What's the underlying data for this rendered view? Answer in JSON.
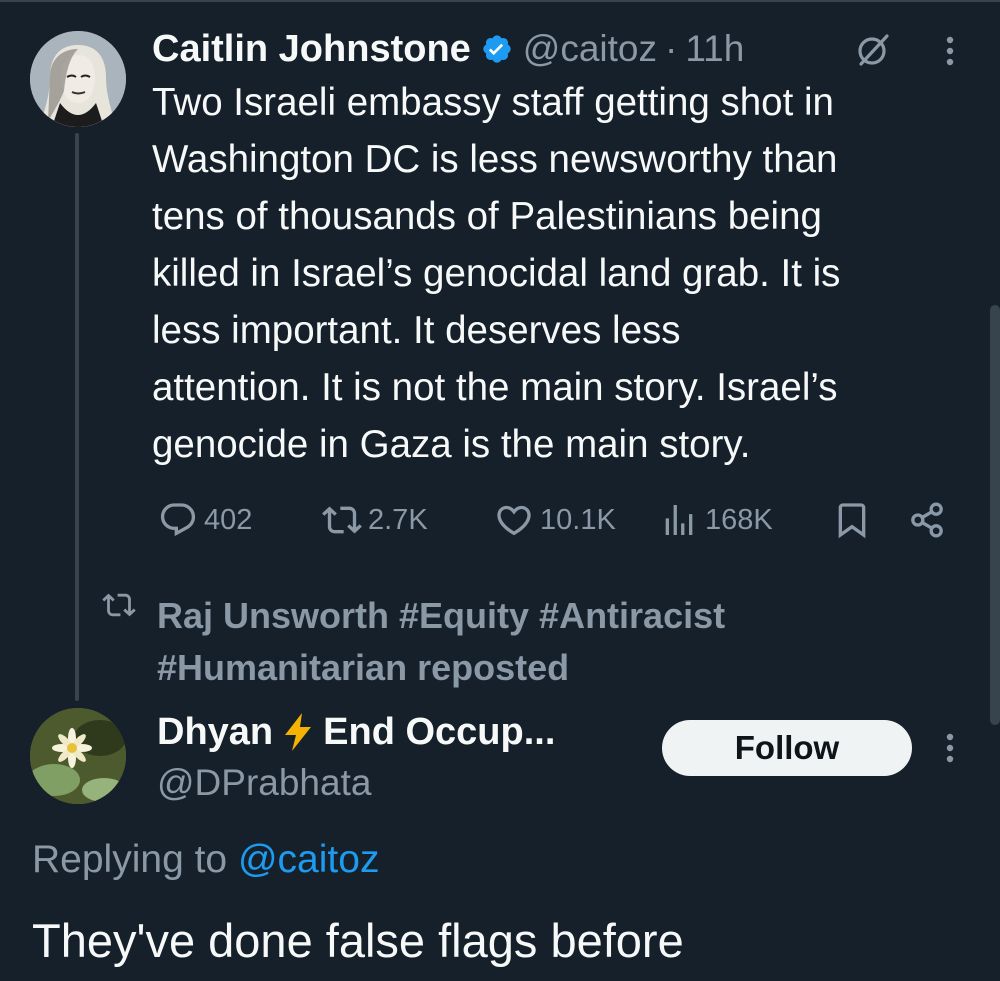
{
  "colors": {
    "background": "#15202b",
    "primary_text": "#f7f9f9",
    "secondary_text": "#8b98a5",
    "accent": "#1d9bf0",
    "divider": "#38444d",
    "verified_badge": "#1d9bf0",
    "follow_button_bg": "#eff3f4"
  },
  "tweet": {
    "author_name": "Caitlin Johnstone",
    "verified": true,
    "handle": "@caitoz",
    "separator": "·",
    "time": "11h",
    "text": "Two Israeli embassy staff getting shot in\nWashington DC is less newsworthy than\ntens of thousands of Palestinians being\nkilled in Israel’s genocidal land grab. It is\nless important. It deserves less\nattention. It is not the main story. Israel’s\ngenocide in Gaza is the main story.",
    "icons": {
      "grok": "grok-icon",
      "more": "more-icon"
    },
    "stats": {
      "replies": "402",
      "reposts": "2.7K",
      "likes": "10.1K",
      "views": "168K"
    }
  },
  "repost_notice": {
    "icon": "repost-icon",
    "text": "Raj Unsworth #Equity #Antiracist #Humanitarian reposted"
  },
  "reply": {
    "author_name_start": "Dhyan",
    "name_emoji": "lightning-bolt",
    "author_name_end": "End Occup...",
    "handle": "@DPrabhata",
    "follow_label": "Follow",
    "replying_prefix": "Replying to",
    "replying_mention": "@caitoz",
    "text": "They've done false flags before"
  }
}
